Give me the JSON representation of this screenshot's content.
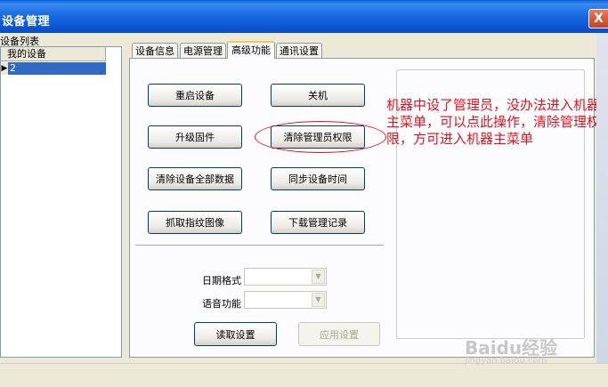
{
  "window": {
    "title": "设备管理",
    "close_symbol": "X"
  },
  "left_panel": {
    "header": "设备列表",
    "tree_header": "我的设备",
    "rows": [
      {
        "arrow": "▶",
        "label": "2"
      }
    ]
  },
  "tabs": [
    {
      "label": "设备信息",
      "active": false
    },
    {
      "label": "电源管理",
      "active": false
    },
    {
      "label": "高级功能",
      "active": true
    },
    {
      "label": "通讯设置",
      "active": false
    }
  ],
  "buttons": {
    "restart": "重启设备",
    "shutdown": "关机",
    "upgrade": "升级固件",
    "clear_admin": "清除管理员权限",
    "clear_all": "清除设备全部数据",
    "sync_time": "同步设备时间",
    "capture_fp": "抓取指纹图像",
    "download_admin_log": "下载管理记录",
    "read_settings": "读取设置",
    "apply_settings": "应用设置"
  },
  "fields": {
    "date_format_label": "日期格式",
    "date_format_value": "",
    "voice_label": "语音功能",
    "voice_value": ""
  },
  "annotation": {
    "text": "机器中设了管理员，没办法进入机器主菜单，可以点此操作，清除管理权限，方可进入机器主菜单",
    "color": "#e0141e"
  },
  "watermark": {
    "logo": "Baidu经验",
    "url": "jingyan.baidu.com"
  },
  "colors": {
    "titlebar": "#0c56d4",
    "selection": "#316ac5",
    "tab_highlight": "#ffc83c"
  }
}
